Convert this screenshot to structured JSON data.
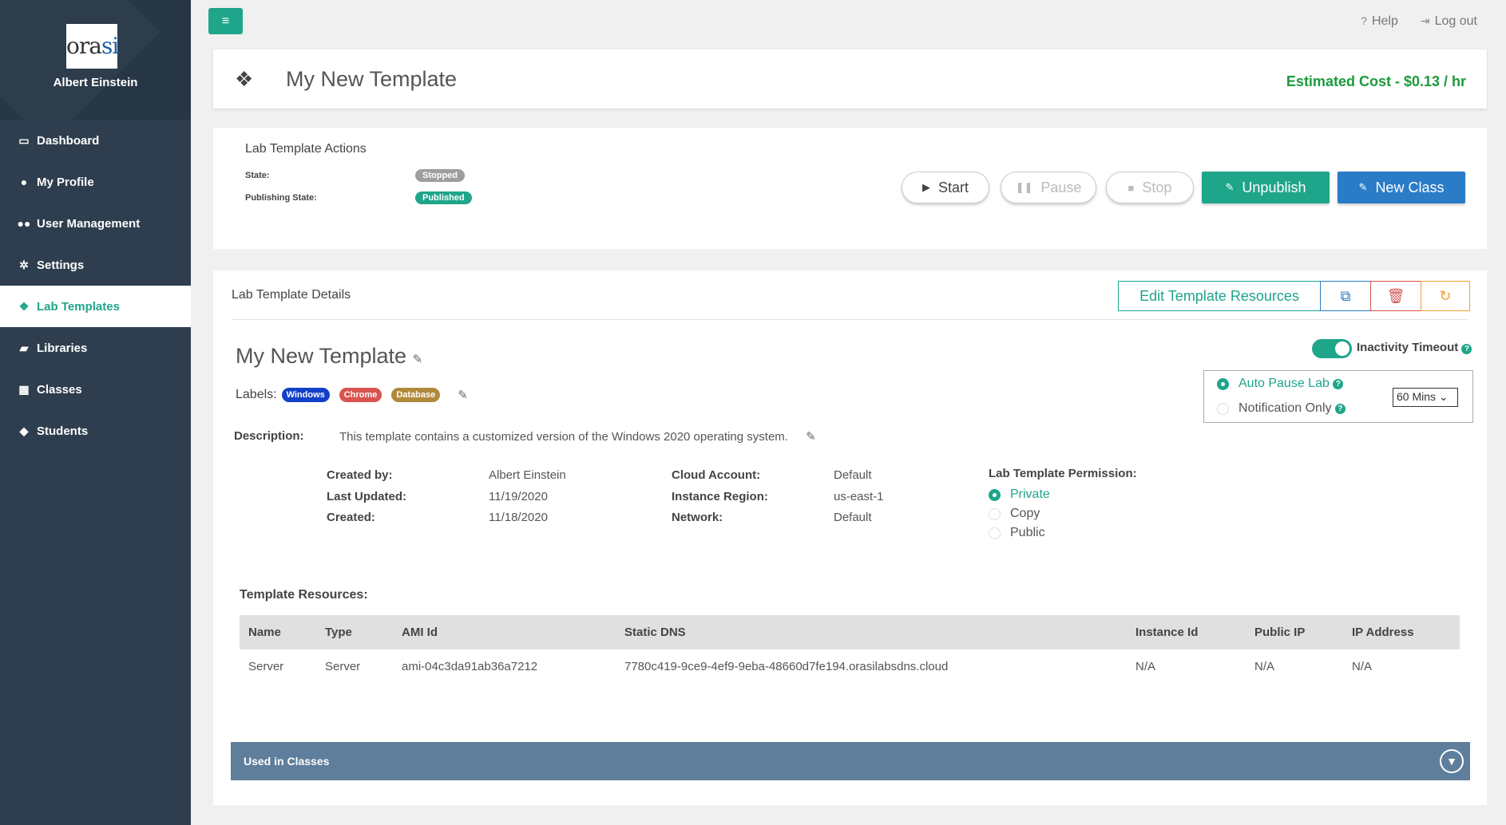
{
  "sidebar": {
    "user_name": "Albert Einstein",
    "logo_text_a": "ora",
    "logo_text_b": "si",
    "items": [
      {
        "label": "Dashboard",
        "icon": "monitor-icon"
      },
      {
        "label": "My Profile",
        "icon": "user-icon"
      },
      {
        "label": "User Management",
        "icon": "users-icon"
      },
      {
        "label": "Settings",
        "icon": "gear-icon"
      },
      {
        "label": "Lab Templates",
        "icon": "cubes-icon",
        "active": true
      },
      {
        "label": "Libraries",
        "icon": "book-icon"
      },
      {
        "label": "Classes",
        "icon": "bank-icon"
      },
      {
        "label": "Students",
        "icon": "graduation-cap-icon"
      }
    ]
  },
  "topbar": {
    "help": "Help",
    "logout": "Log out"
  },
  "title_card": {
    "title": "My New Template",
    "cost": "Estimated Cost - $0.13 / hr"
  },
  "actions": {
    "heading": "Lab Template Actions",
    "state_label": "State:",
    "state_value": "Stopped",
    "publishing_label": "Publishing State:",
    "publishing_value": "Published",
    "start": "Start",
    "pause": "Pause",
    "stop": "Stop",
    "unpublish": "Unpublish",
    "new_class": "New Class"
  },
  "details": {
    "heading": "Lab Template Details",
    "edit_resources": "Edit Template Resources",
    "name": "My New Template",
    "labels_label": "Labels:",
    "labels": [
      {
        "text": "Windows",
        "color": "#1240c8"
      },
      {
        "text": "Chrome",
        "color": "#d9534f"
      },
      {
        "text": "Database",
        "color": "#b08a3a"
      }
    ],
    "description_label": "Description:",
    "description": "This template contains a customized version of the Windows 2020 operating system.",
    "created_by_label": "Created by:",
    "created_by": "Albert Einstein",
    "last_updated_label": "Last Updated:",
    "last_updated": "11/19/2020",
    "created_label": "Created:",
    "created": "11/18/2020",
    "cloud_account_label": "Cloud Account:",
    "cloud_account": "Default",
    "instance_region_label": "Instance Region:",
    "instance_region": "us-east-1",
    "network_label": "Network:",
    "network": "Default",
    "permission_label": "Lab Template Permission:",
    "permission_options": [
      "Private",
      "Copy",
      "Public"
    ],
    "permission_selected": "Private",
    "inactivity_label": "Inactivity Timeout",
    "inactivity_enabled": true,
    "auto_pause_label": "Auto Pause Lab",
    "notification_label": "Notification Only",
    "timeout_value": "60 Mins",
    "resources_label": "Template Resources:",
    "resource_columns": [
      "Name",
      "Type",
      "AMI Id",
      "Static DNS",
      "Instance Id",
      "Public IP",
      "IP Address"
    ],
    "resource_rows": [
      [
        "Server",
        "Server",
        "ami-04c3da91ab36a7212",
        "7780c419-9ce9-4ef9-9eba-48660d7fe194.orasilabsdns.cloud",
        "N/A",
        "N/A",
        "N/A"
      ]
    ],
    "used_in_classes": "Used in Classes"
  },
  "colors": {
    "accent": "#1fa58a",
    "primary": "#2a7cc7",
    "sidebar": "#2e3e4e",
    "cost": "#1c9a3c"
  }
}
